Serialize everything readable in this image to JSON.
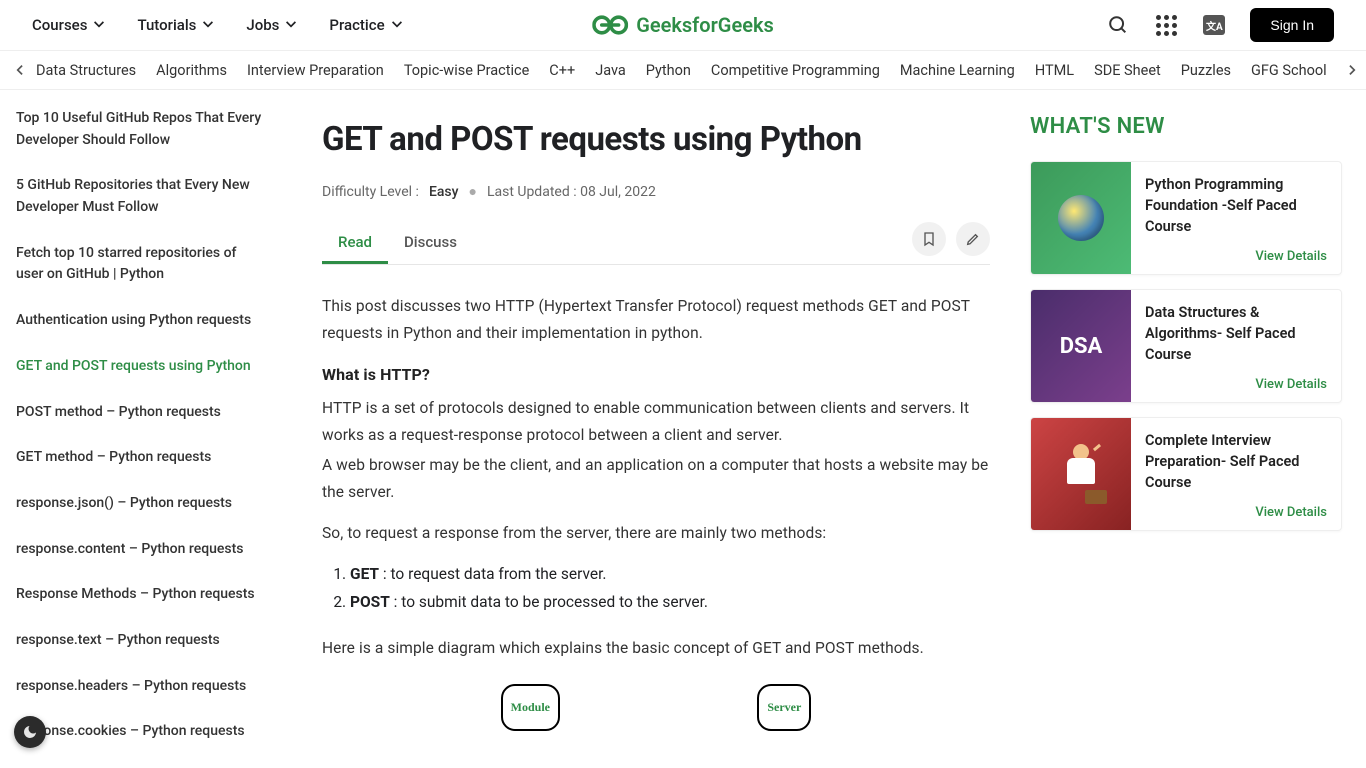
{
  "topnav": {
    "items": [
      "Courses",
      "Tutorials",
      "Jobs",
      "Practice"
    ],
    "brand": "GeeksforGeeks",
    "signin": "Sign In"
  },
  "secnav": {
    "items": [
      "Data Structures",
      "Algorithms",
      "Interview Preparation",
      "Topic-wise Practice",
      "C++",
      "Java",
      "Python",
      "Competitive Programming",
      "Machine Learning",
      "HTML",
      "SDE Sheet",
      "Puzzles",
      "GFG School"
    ]
  },
  "sidebar": {
    "items": [
      "Top 10 Useful GitHub Repos That Every Developer Should Follow",
      "5 GitHub Repositories that Every New Developer Must Follow",
      "Fetch top 10 starred repositories of user on GitHub | Python",
      "Authentication using Python requests",
      "GET and POST requests using Python",
      "POST method – Python requests",
      "GET method – Python requests",
      "response.json() – Python requests",
      "response.content – Python requests",
      "Response Methods – Python requests",
      "response.text – Python requests",
      "response.headers – Python requests",
      "response.cookies – Python requests"
    ],
    "active_index": 4
  },
  "article": {
    "title": "GET and POST requests using Python",
    "difficulty_label": "Difficulty Level :",
    "difficulty_value": "Easy",
    "updated_label": "Last Updated :",
    "updated_value": "08 Jul, 2022",
    "tabs": [
      "Read",
      "Discuss"
    ],
    "active_tab": 0,
    "intro": "This post discusses two HTTP (Hypertext Transfer Protocol) request methods  GET and POST requests in Python and their implementation in python.",
    "sec1_heading": "What is HTTP?",
    "sec1_p1": "HTTP is a set of protocols designed to enable communication between clients and servers. It works as a request-response protocol between a client and server.",
    "sec1_p2": "A web browser may be the client, and an application on a computer that hosts a website may be the server.",
    "sec1_p3": "So, to request a response from the server, there are mainly two methods:",
    "methods": [
      {
        "name": "GET",
        "desc": " : to request data from the server."
      },
      {
        "name": "POST",
        "desc": " : to submit data to be processed to the server."
      }
    ],
    "sec1_p4": "Here is a simple diagram which explains the basic concept of GET and POST methods.",
    "diagram": {
      "left": "Module",
      "right": "Server"
    }
  },
  "rightrail": {
    "heading": "WHAT'S NEW",
    "view_label": "View Details",
    "cards": [
      {
        "title": "Python Programming Foundation -Self Paced Course",
        "thumb": "py"
      },
      {
        "title": "Data Structures & Algorithms- Self Paced Course",
        "thumb": "dsa",
        "thumb_text": "DSA"
      },
      {
        "title": "Complete Interview Preparation- Self Paced Course",
        "thumb": "int"
      }
    ]
  }
}
